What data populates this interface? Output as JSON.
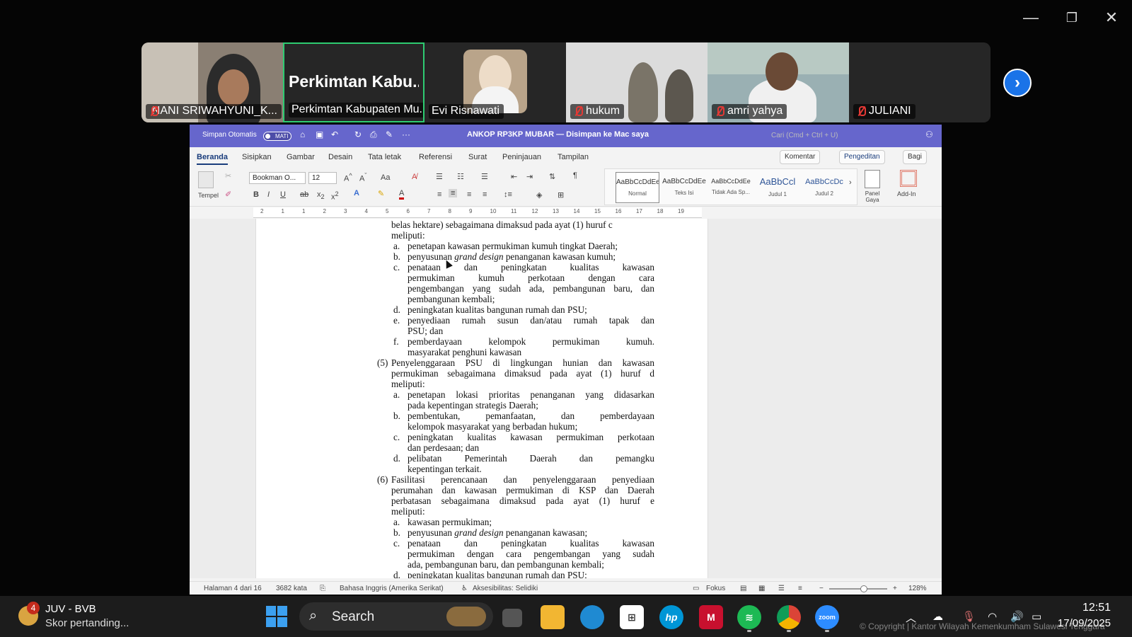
{
  "window_controls": {
    "minimize": "—",
    "restore": "❐",
    "close": "✕"
  },
  "participants": [
    {
      "name": "NANI SRIWAHYUNI_K...",
      "muted": true
    },
    {
      "name": "Perkimtan Kabupaten Mu...",
      "big_label": "Perkimtan  Kabu...",
      "muted": false,
      "active_speaker": true
    },
    {
      "name": "Evi Risnawati",
      "muted": false
    },
    {
      "name": "hukum",
      "muted": true
    },
    {
      "name": "amri yahya",
      "muted": true
    },
    {
      "name": "JULIANI",
      "muted": true
    }
  ],
  "next_page": "›",
  "word": {
    "autosave_label": "Simpan Otomatis",
    "autosave_state": "MATI",
    "doc_title": "ANKOP RP3KP MUBAR — Disimpan ke Mac saya",
    "search_placeholder": "Cari (Cmd + Ctrl + U)",
    "tabs": [
      "Beranda",
      "Sisipkan",
      "Gambar",
      "Desain",
      "Tata letak",
      "Referensi",
      "Surat",
      "Peninjauan",
      "Tampilan"
    ],
    "comment_btn": "Komentar",
    "edit_btn": "Pengeditan",
    "share_btn": "Bagi",
    "paste_label": "Tempel",
    "font_name": "Bookman O...",
    "font_size": "12",
    "aa": "Aa",
    "styles": [
      {
        "preview": "AaBbCcDdEe",
        "name": "Normal"
      },
      {
        "preview": "AaBbCcDdEe",
        "name": "Teks Isi"
      },
      {
        "preview": "AaBbCcDdEe",
        "name": "Tidak Ada Sp..."
      },
      {
        "preview": "AaBbCcl",
        "name": "Judul 1"
      },
      {
        "preview": "AaBbCcDc",
        "name": "Judul 2"
      }
    ],
    "panel_gaya": "Panel Gaya",
    "addin": "Add-In",
    "ruler_numbers": [
      "2",
      "1",
      "1",
      "2",
      "3",
      "4",
      "5",
      "6",
      "7",
      "8",
      "9",
      "10",
      "11",
      "12",
      "13",
      "14",
      "15",
      "16",
      "17",
      "18",
      "19"
    ],
    "status": {
      "page": "Halaman 4 dari 16",
      "words": "3682 kata",
      "language": "Bahasa Inggris (Amerika Serikat)",
      "accessibility": "Aksesibilitas: Selidiki",
      "focus": "Fokus",
      "zoom": "128%"
    }
  },
  "document": {
    "lines": [
      {
        "t": "belas hektare) sebagaimana dimaksud pada ayat (1) huruf c",
        "indent": 1
      },
      {
        "t": "meliputi:",
        "indent": 1
      },
      {
        "m": "a.",
        "t": "penetapan kawasan permukiman kumuh tingkat Daerah;",
        "indent": 2
      },
      {
        "m": "b.",
        "t": "penyusunan grand design penanganan kawasan kumuh;",
        "indent": 2
      },
      {
        "m": "c.",
        "t": "penataan dan peningkatan kualitas kawasan",
        "indent": 2,
        "j": true
      },
      {
        "t": "permukiman kumuh perkotaan dengan cara",
        "indent": 2,
        "j": true
      },
      {
        "t": "pengembangan yang sudah ada, pembangunan baru, dan",
        "indent": 2,
        "j": true
      },
      {
        "t": "pembangunan kembali;",
        "indent": 2
      },
      {
        "m": "d.",
        "t": "peningkatan kualitas bangunan rumah dan PSU;",
        "indent": 2
      },
      {
        "m": "e.",
        "t": "penyediaan rumah susun dan/atau rumah tapak dan",
        "indent": 2,
        "j": true
      },
      {
        "t": "PSU; dan",
        "indent": 2
      },
      {
        "m": "f.",
        "t": "pemberdayaan kelompok permukiman kumuh.",
        "indent": 2,
        "j": true
      },
      {
        "t": "masyarakat penghuni kawasan",
        "indent": 2
      },
      {
        "m": "(5)",
        "t": "Penyelenggaraan PSU di lingkungan hunian dan kawasan",
        "indent": 1,
        "j": true
      },
      {
        "t": "permukiman sebagaimana dimaksud pada ayat (1) huruf d",
        "indent": 1,
        "j": true
      },
      {
        "t": "meliputi:",
        "indent": 1
      },
      {
        "m": "a.",
        "t": "penetapan lokasi prioritas penanganan yang didasarkan",
        "indent": 2,
        "j": true
      },
      {
        "t": "pada kepentingan strategis Daerah;",
        "indent": 2
      },
      {
        "m": "b.",
        "t": "pembentukan, pemanfaatan, dan pemberdayaan",
        "indent": 2,
        "j": true
      },
      {
        "t": "kelompok masyarakat yang berbadan hukum;",
        "indent": 2
      },
      {
        "m": "c.",
        "t": "peningkatan kualitas kawasan permukiman perkotaan",
        "indent": 2,
        "j": true
      },
      {
        "t": "dan perdesaan; dan",
        "indent": 2
      },
      {
        "m": "d.",
        "t": "pelibatan Pemerintah Daerah dan pemangku",
        "indent": 2,
        "j": true
      },
      {
        "t": "kepentingan terkait.",
        "indent": 2
      },
      {
        "m": "(6)",
        "t": "Fasilitasi perencanaan dan penyelenggaraan penyediaan",
        "indent": 1,
        "j": true
      },
      {
        "t": "perumahan dan kawasan permukiman di KSP dan Daerah",
        "indent": 1,
        "j": true
      },
      {
        "t": "perbatasan sebagaimana dimaksud pada ayat (1) huruf e",
        "indent": 1,
        "j": true
      },
      {
        "t": "meliputi:",
        "indent": 1
      },
      {
        "m": "a.",
        "t": "kawasan permukiman;",
        "indent": 2
      },
      {
        "m": "b.",
        "t": "penyusunan grand design penanganan kawasan;",
        "indent": 2
      },
      {
        "m": "c.",
        "t": "penataan dan peningkatan kualitas kawasan",
        "indent": 2,
        "j": true
      },
      {
        "t": "permukiman dengan cara pengembangan yang sudah",
        "indent": 2,
        "j": true
      },
      {
        "t": "ada, pembangunan baru, dan pembangunan kembali;",
        "indent": 2
      },
      {
        "m": "d.",
        "t": "peningkatan kualitas bangunan rumah dan PSU;",
        "indent": 2
      }
    ]
  },
  "taskbar": {
    "widget_badge": "4",
    "widget_title": "JUV - BVB",
    "widget_sub": "Skor pertanding...",
    "search": "Search",
    "apps": [
      "windows-start",
      "file-explorer",
      "edge",
      "store",
      "hp",
      "mcafee",
      "spotify",
      "chrome",
      "zoom"
    ],
    "time": "12:51",
    "date": "17/09/2025",
    "copyright": "© Copyright | Kantor Wilayah Kemenkumham Sulawesi Tenggara"
  }
}
